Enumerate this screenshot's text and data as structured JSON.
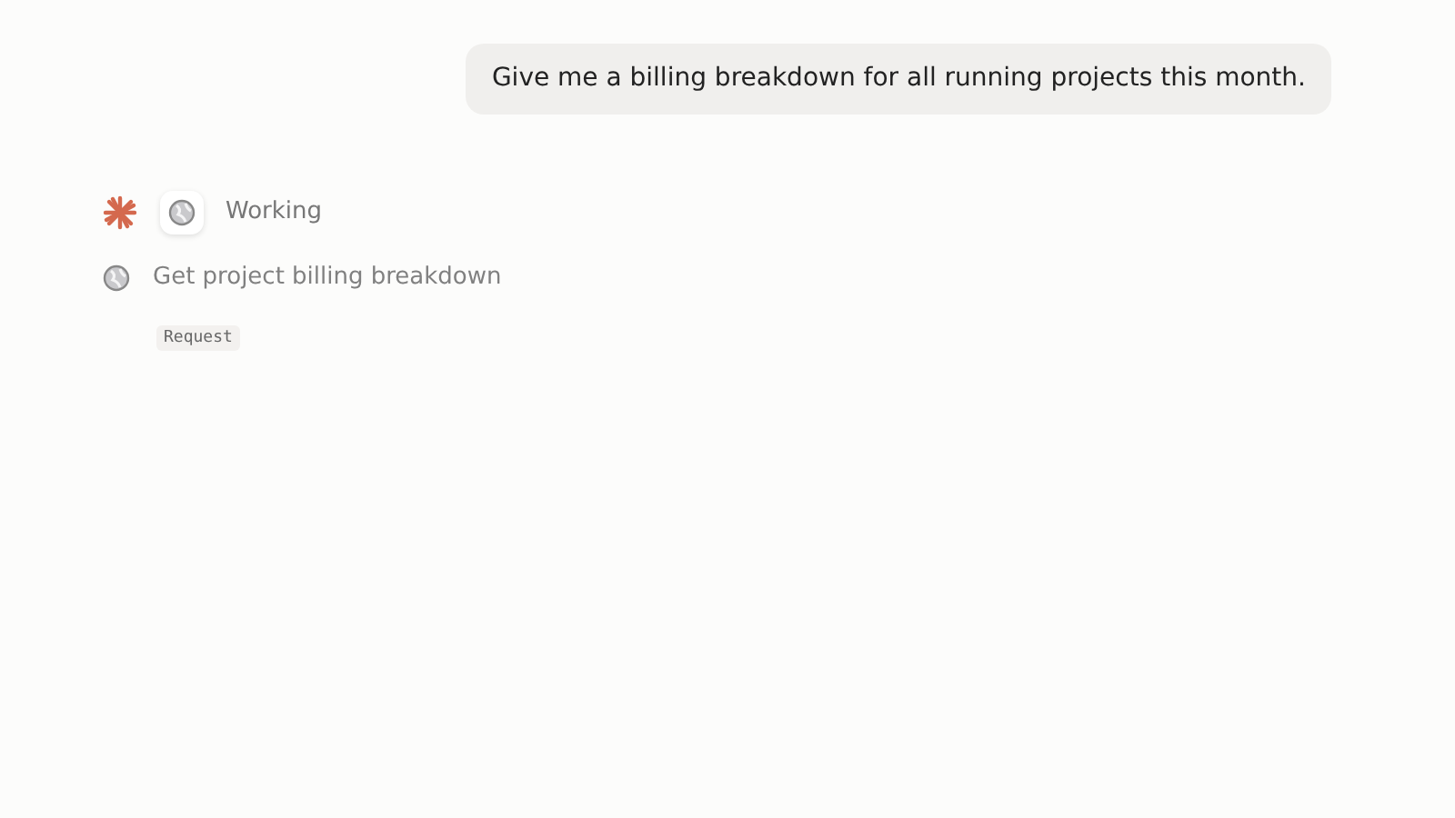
{
  "user_message": "Give me a billing breakdown for all running projects this month.",
  "status": {
    "label": "Working"
  },
  "tool_calls": [
    {
      "title": "Get project billing breakdown",
      "tag": "Request"
    }
  ]
}
